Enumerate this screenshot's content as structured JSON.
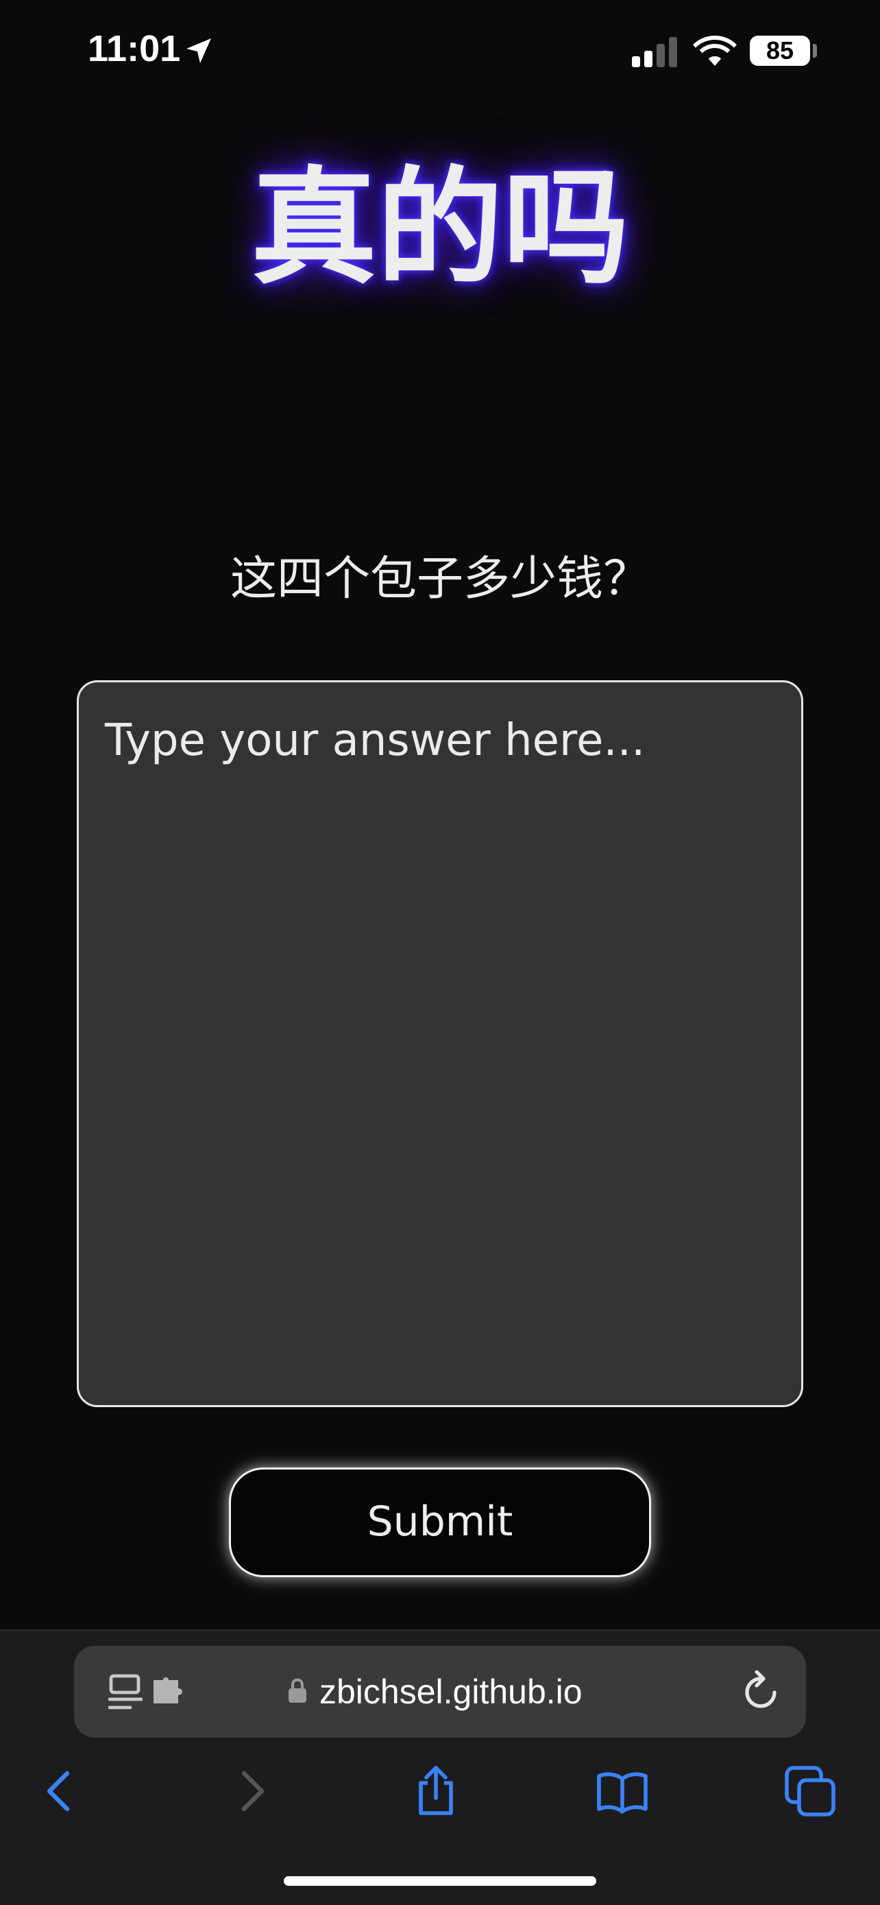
{
  "status_bar": {
    "time": "11:01",
    "battery": "85",
    "icons": [
      "location-arrow-icon",
      "cellular-signal-icon",
      "wifi-icon",
      "battery-icon"
    ]
  },
  "page": {
    "title": "真的吗",
    "question": "这四个包子多少钱？",
    "answer_placeholder": "Type your answer here...",
    "answer_value": "",
    "submit_label": "Submit"
  },
  "browser": {
    "url": "zbichsel.github.io",
    "icons": [
      "reader-mode-icon",
      "extension-icon",
      "lock-icon",
      "reload-icon",
      "back-icon",
      "forward-icon",
      "share-icon",
      "bookmarks-icon",
      "tabs-icon"
    ]
  },
  "colors": {
    "background": "#0a0a0a",
    "title_glow": "#3a22e0",
    "textarea_bg": "#333333",
    "accent_blue": "#3b82f6",
    "chrome_bg": "#1c1c1e"
  }
}
